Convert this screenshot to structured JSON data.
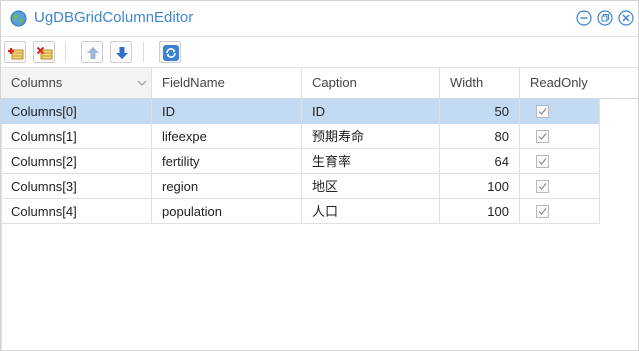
{
  "window": {
    "title": "UgDBGridColumnEditor"
  },
  "title_buttons": [
    "minimize-icon",
    "restore-icon",
    "close-icon"
  ],
  "toolbar": {
    "buttons": [
      {
        "name": "add-column-button",
        "icon": "add-column-icon"
      },
      {
        "name": "delete-column-button",
        "icon": "delete-column-icon"
      },
      {
        "name": "move-up-button",
        "icon": "arrow-up-icon"
      },
      {
        "name": "move-down-button",
        "icon": "arrow-down-icon"
      },
      {
        "name": "refresh-button",
        "icon": "refresh-icon"
      }
    ]
  },
  "grid": {
    "headers": [
      "Columns",
      "FieldName",
      "Caption",
      "Width",
      "ReadOnly"
    ],
    "rows": [
      {
        "column": "Columns[0]",
        "field": "ID",
        "caption": "ID",
        "width": "50",
        "readonly": true,
        "selected": true
      },
      {
        "column": "Columns[1]",
        "field": "lifeexpe",
        "caption": "预期寿命",
        "width": "80",
        "readonly": true,
        "selected": false
      },
      {
        "column": "Columns[2]",
        "field": "fertility",
        "caption": "生育率",
        "width": "64",
        "readonly": true,
        "selected": false
      },
      {
        "column": "Columns[3]",
        "field": "region",
        "caption": "地区",
        "width": "100",
        "readonly": true,
        "selected": false
      },
      {
        "column": "Columns[4]",
        "field": "population",
        "caption": "人口",
        "width": "100",
        "readonly": true,
        "selected": false
      }
    ]
  },
  "colors": {
    "title": "#3f86cd",
    "selected_row": "#c2dbf3",
    "toolbar_accent": "#2f6fc4"
  }
}
